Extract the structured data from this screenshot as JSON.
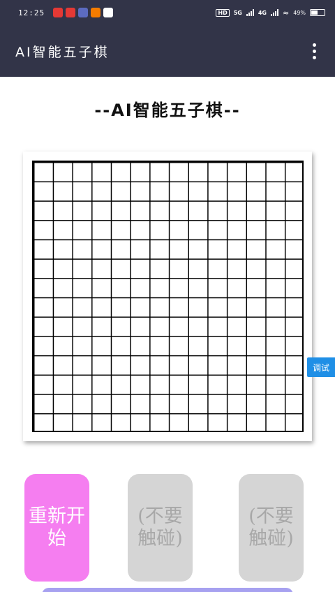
{
  "status_bar": {
    "time": "12:25",
    "network": "5G",
    "network2": "4G",
    "hd": "HD",
    "battery": "49%"
  },
  "app_bar": {
    "title": "AI智能五子棋"
  },
  "page": {
    "heading": "--AI智能五子棋--"
  },
  "debug_tab": {
    "label": "调试"
  },
  "buttons": {
    "restart": "重新开始",
    "dont_touch_1": "(不要触碰)",
    "dont_touch_2": "(不要触碰)"
  },
  "colors": {
    "app_bar_bg": "#323448",
    "restart_bg": "#f57ef0",
    "disabled_bg": "#d5d5d5",
    "debug_tab_bg": "#1f8fe6",
    "bottom_bar": "#a7a1f0"
  }
}
